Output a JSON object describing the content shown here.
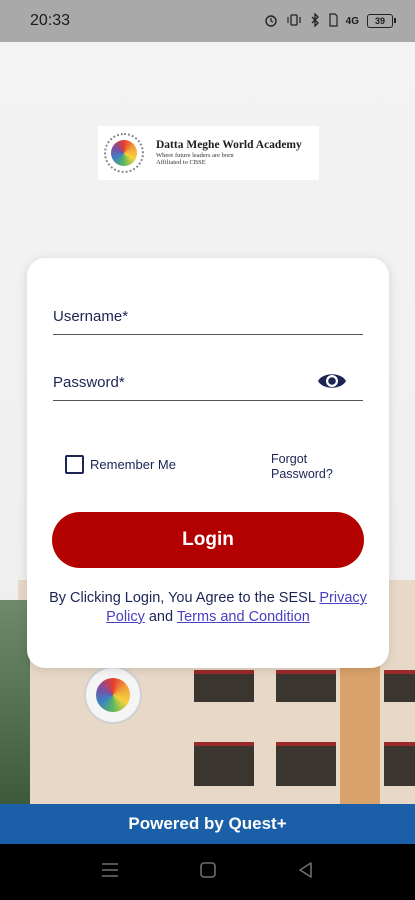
{
  "status_bar": {
    "time": "20:33",
    "signal_text": "4G",
    "battery": "39"
  },
  "logo": {
    "title": "Datta Meghe World Academy",
    "tagline": "Where future leaders are born",
    "affiliation": "Affiliated to CBSE"
  },
  "login_form": {
    "username_label": "Username*",
    "password_label": "Password*",
    "remember_label": "Remember Me",
    "remember_checked": false,
    "forgot_line1": "Forgot",
    "forgot_line2": "Password?",
    "login_label": "Login",
    "agree_text": "By Clicking Login, You Agree to the SESL",
    "privacy_link": "Privacy Policy",
    "and_text": "and",
    "terms_link": "Terms and Condition"
  },
  "footer": {
    "powered_by": "Powered by Quest+"
  },
  "colors": {
    "primary_red": "#b30000",
    "navy": "#1c2554",
    "footer_blue": "#1a5fa8",
    "link": "#4a3fc0"
  },
  "icons": [
    "alarm-icon",
    "vibrate-icon",
    "bluetooth-icon",
    "signal-icon",
    "battery-icon",
    "eye-icon",
    "menu-icon",
    "home-icon",
    "back-icon"
  ]
}
